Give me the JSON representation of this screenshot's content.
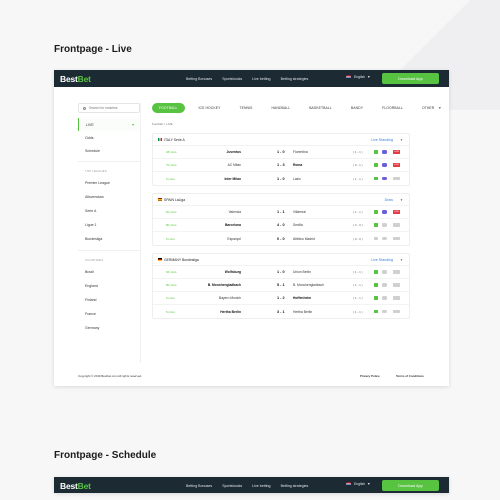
{
  "titles": {
    "live": "Frontpage - Live",
    "schedule": "Frontpage - Schedule"
  },
  "topbar": {
    "logo_part1": "Best",
    "logo_part2": "Bet",
    "nav": [
      "Betting Bonuses",
      "Sportsbooks",
      "Live betting",
      "Betting strategies"
    ],
    "language": "English",
    "download_label": "Download App"
  },
  "sidebar": {
    "search_placeholder": "Search for matches",
    "main_items": [
      "LIVE",
      "Odds",
      "Schedule"
    ],
    "top_leagues_header": "TOP LEAGUES",
    "leagues": [
      "Premier League",
      "Allsvenskan",
      "Serie A",
      "Ligue 1",
      "Bundesliga"
    ],
    "countries_header": "COUNTRIES",
    "countries": [
      "Brazil",
      "England",
      "Finland",
      "France",
      "Germany"
    ]
  },
  "main": {
    "tabs": [
      "FOOTBALL",
      "ICE HOCKEY",
      "TENNIS",
      "HANDBALL",
      "BASKETBALL",
      "BANDY",
      "FLOORBALL",
      "OTHER"
    ],
    "breadcrumb": "Football > LIVE",
    "leagues": [
      {
        "name": "ITALY Serie A",
        "status": "Live Standing",
        "matches": [
          {
            "time": "28 mins",
            "home": "Juventus",
            "score": "1 - 0",
            "away": "Fiorentina",
            "ht": "( 1 - 1 )"
          },
          {
            "time": "70 mins",
            "home": "AC Milan",
            "score": "1 - 3",
            "away": "Roma",
            "ht": "( 0 - 1 )"
          },
          {
            "time": "5 mins",
            "home": "Inter Milan",
            "score": "1 - 0",
            "away": "Lazio",
            "ht": "( 1 - 1 )"
          }
        ]
      },
      {
        "name": "SPAIN LaLiga",
        "status": "Draw",
        "matches": [
          {
            "time": "60 mins",
            "home": "Valencia",
            "score": "1 - 1",
            "away": "Villarreal",
            "ht": "( 1 - 1 )"
          },
          {
            "time": "80 mins",
            "home": "Barcelona",
            "score": "4 - 0",
            "away": "Sevilla",
            "ht": "( 3 - 0 )"
          },
          {
            "time": "5 mins",
            "home": "Espanyol",
            "score": "0 - 0",
            "away": "Atlético Madrid",
            "ht": "( 0 - 0 )"
          }
        ]
      },
      {
        "name": "GERMANY Bundesliga",
        "status": "Live Standing",
        "matches": [
          {
            "time": "66 mins",
            "home": "Wolfsburg",
            "score": "1 - 0",
            "away": "Union Berlin",
            "ht": "( 1 - 1 )"
          },
          {
            "time": "80 mins",
            "home": "B. Monchengladbach",
            "score": "5 - 1",
            "away": "B. Monchengladbach",
            "ht": "( 1 - 1 )"
          },
          {
            "time": "5 mins",
            "home": "Bayern Munich",
            "score": "1 - 2",
            "away": "Hoffenheim",
            "ht": "( 1 - 1 )"
          },
          {
            "time": "5 mins",
            "home": "Hertha Berlin",
            "score": "3 - 1",
            "away": "Hertha Berlin",
            "ht": "( 1 - 1 )"
          }
        ]
      }
    ],
    "tv_label": "LIVE"
  },
  "footer": {
    "copyright": "Copyright © 2019 Bestbet.com All rights reserved.",
    "privacy": "Privacy Police",
    "terms": "Terms of Conditions"
  }
}
